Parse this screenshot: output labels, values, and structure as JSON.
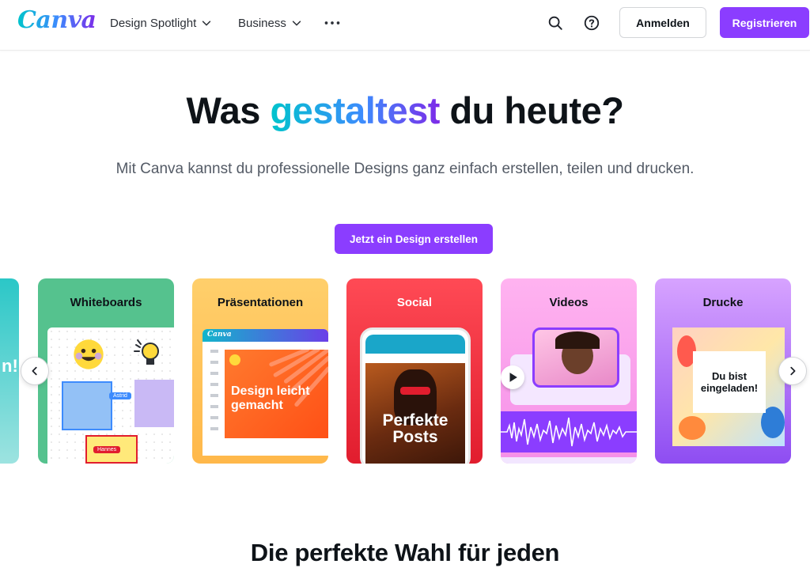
{
  "header": {
    "logo": "Canva",
    "nav": [
      {
        "label": "Design Spotlight",
        "icon": "chevron-down-icon"
      },
      {
        "label": "Business",
        "icon": "chevron-down-icon"
      }
    ],
    "more_icon": "more-horizontal-icon",
    "login_label": "Anmelden",
    "register_label": "Registrieren"
  },
  "hero": {
    "title_before": "Was ",
    "title_highlight": "gestaltest",
    "title_after": " du heute?",
    "subtitle": "Mit Canva kannst du professionelle Designs ganz einfach erstellen, teilen und drucken.",
    "cta_label": "Jetzt ein Design erstellen"
  },
  "carousel": {
    "cards": [
      {
        "title": "Whiteboards",
        "chips": [
          "Astrid",
          "Hannes"
        ]
      },
      {
        "title": "Präsentationen",
        "slide_text": "Design leicht gemacht",
        "brand": "Canva"
      },
      {
        "title": "Social",
        "post_text": "Perfekte Posts"
      },
      {
        "title": "Videos"
      },
      {
        "title": "Drucke",
        "print_text": "Du bist eingeladen!"
      }
    ],
    "partial_card_text": "n!"
  },
  "section": {
    "title": "Die perfekte Wahl für jeden"
  },
  "colors": {
    "accent": "#8b3dff",
    "gradient_start": "#00c4cc",
    "gradient_end": "#7d2ae8"
  }
}
